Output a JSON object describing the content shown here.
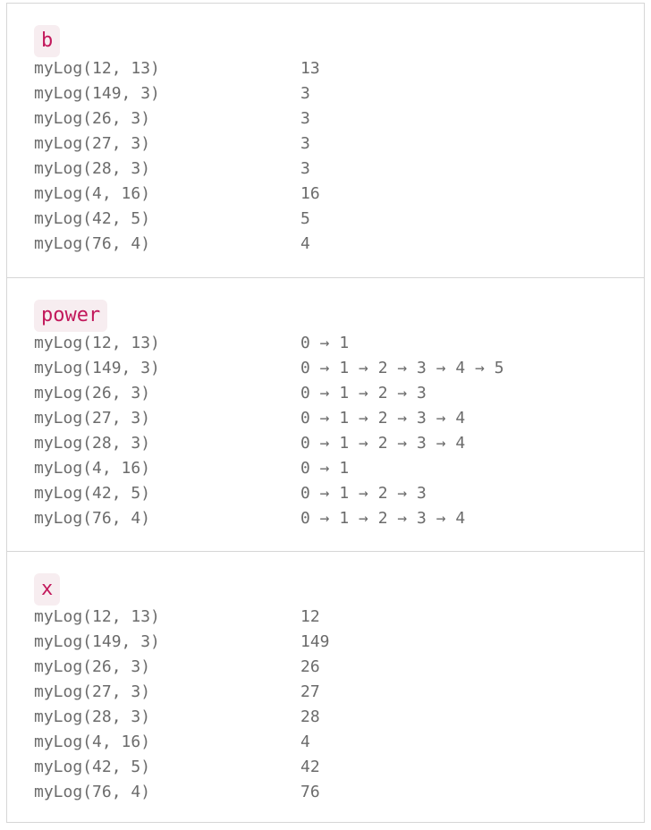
{
  "sections": [
    {
      "variable": "b",
      "rows": [
        {
          "call": "myLog(12, 13)",
          "value": "13"
        },
        {
          "call": "myLog(149, 3)",
          "value": "3"
        },
        {
          "call": "myLog(26, 3)",
          "value": "3"
        },
        {
          "call": "myLog(27, 3)",
          "value": "3"
        },
        {
          "call": "myLog(28, 3)",
          "value": "3"
        },
        {
          "call": "myLog(4, 16)",
          "value": "16"
        },
        {
          "call": "myLog(42, 5)",
          "value": "5"
        },
        {
          "call": "myLog(76, 4)",
          "value": "4"
        }
      ]
    },
    {
      "variable": "power",
      "rows": [
        {
          "call": "myLog(12, 13)",
          "value": "0 → 1"
        },
        {
          "call": "myLog(149, 3)",
          "value": "0 → 1 → 2 → 3 → 4 → 5"
        },
        {
          "call": "myLog(26, 3)",
          "value": "0 → 1 → 2 → 3"
        },
        {
          "call": "myLog(27, 3)",
          "value": "0 → 1 → 2 → 3 → 4"
        },
        {
          "call": "myLog(28, 3)",
          "value": "0 → 1 → 2 → 3 → 4"
        },
        {
          "call": "myLog(4, 16)",
          "value": "0 → 1"
        },
        {
          "call": "myLog(42, 5)",
          "value": "0 → 1 → 2 → 3"
        },
        {
          "call": "myLog(76, 4)",
          "value": "0 → 1 → 2 → 3 → 4"
        }
      ]
    },
    {
      "variable": "x",
      "rows": [
        {
          "call": "myLog(12, 13)",
          "value": "12"
        },
        {
          "call": "myLog(149, 3)",
          "value": "149"
        },
        {
          "call": "myLog(26, 3)",
          "value": "26"
        },
        {
          "call": "myLog(27, 3)",
          "value": "27"
        },
        {
          "call": "myLog(28, 3)",
          "value": "28"
        },
        {
          "call": "myLog(4, 16)",
          "value": "4"
        },
        {
          "call": "myLog(42, 5)",
          "value": "42"
        },
        {
          "call": "myLog(76, 4)",
          "value": "76"
        }
      ]
    }
  ]
}
